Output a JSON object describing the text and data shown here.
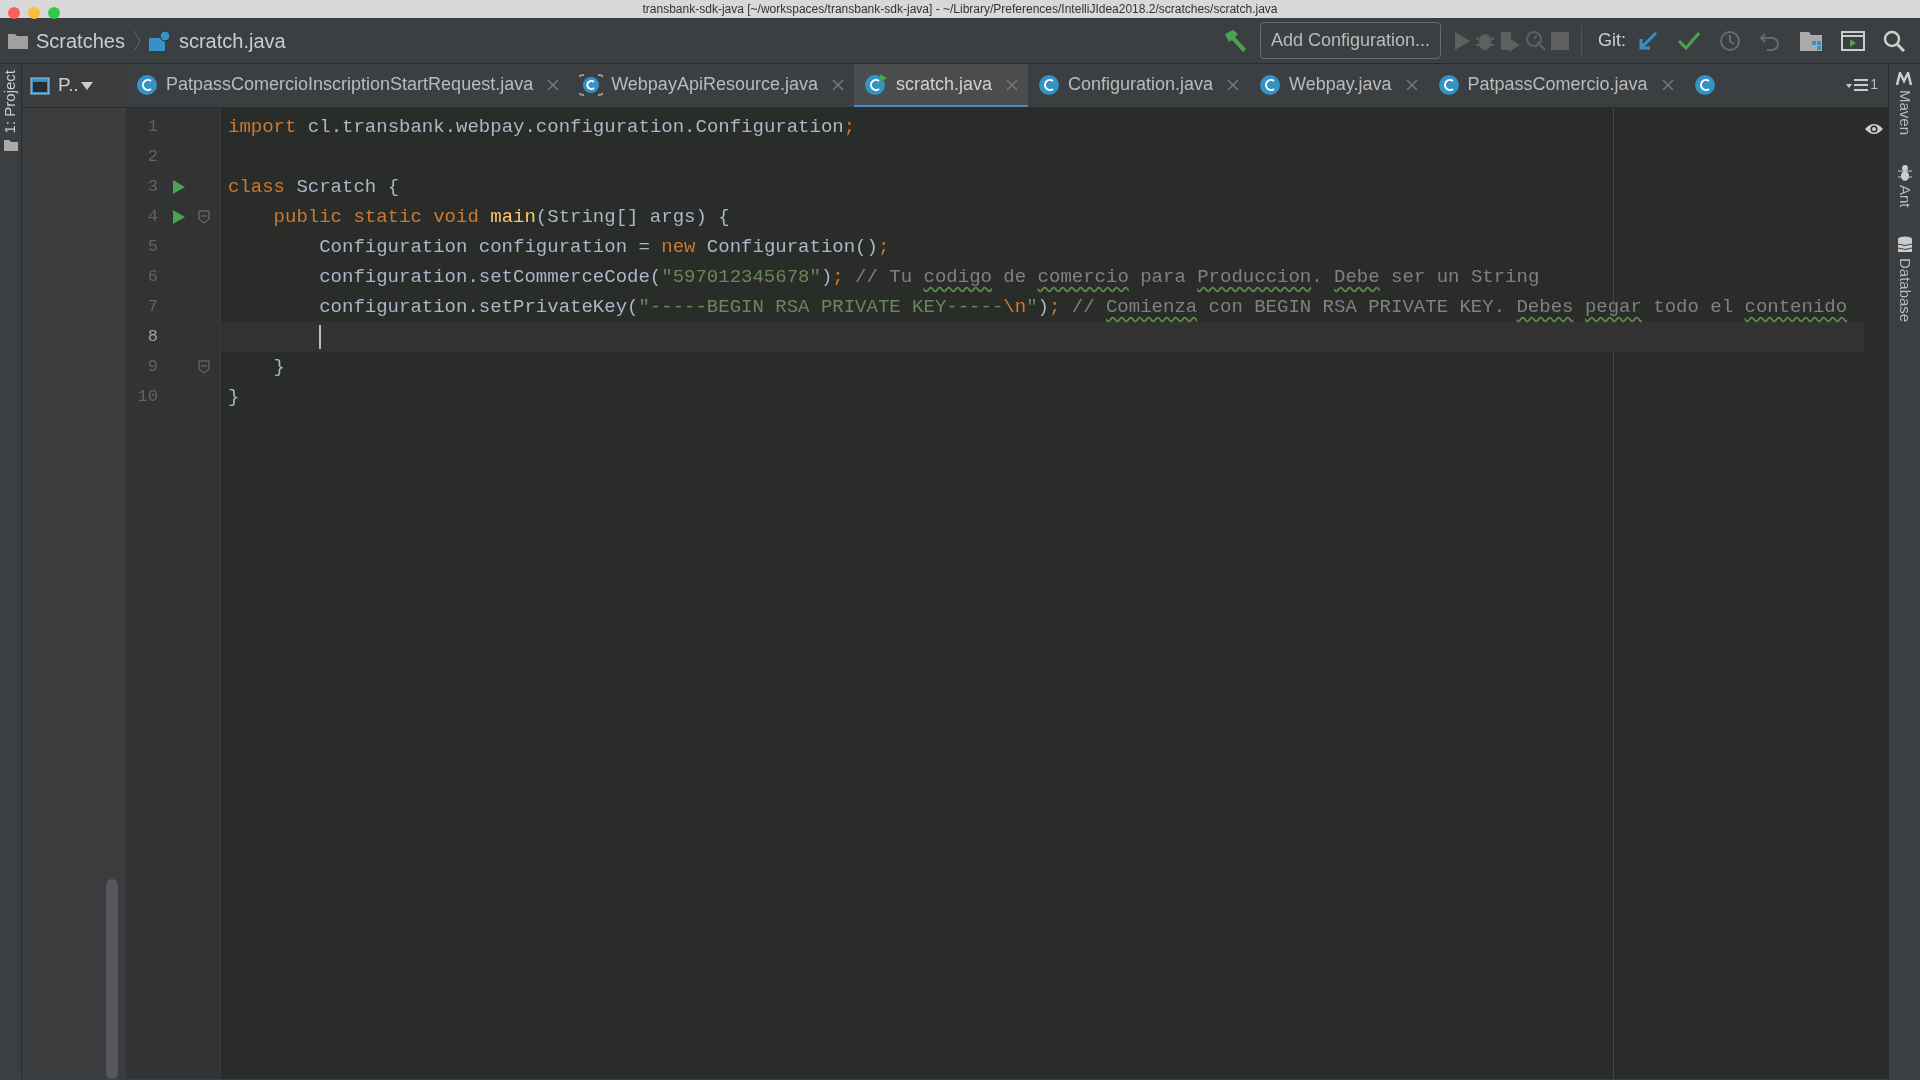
{
  "window": {
    "title": "transbank-sdk-java [~/workspaces/transbank-sdk-java] - ~/Library/Preferences/IntelliJIdea2018.2/scratches/scratch.java"
  },
  "breadcrumb": [
    {
      "label": "Scratches",
      "kind": "folder"
    },
    {
      "label": "scratch.java",
      "kind": "scratch"
    }
  ],
  "toolbar": {
    "config_button": "Add Configuration...",
    "git_label": "Git:",
    "run_buttons": [
      {
        "kind": "run",
        "disabled": true
      },
      {
        "kind": "debug",
        "disabled": true
      },
      {
        "kind": "coverage",
        "disabled": true
      },
      {
        "kind": "profile",
        "disabled": true
      },
      {
        "kind": "stop",
        "disabled": true
      }
    ]
  },
  "left_strip": {
    "label": "1: Project"
  },
  "project_panel": {
    "label": "P.."
  },
  "tabs": [
    {
      "label": "PatpassComercioInscriptionStartRequest.java",
      "kind": "class",
      "selected": false
    },
    {
      "label": "WebpayApiResource.java",
      "kind": "abstract",
      "selected": false
    },
    {
      "label": "scratch.java",
      "kind": "scratch",
      "selected": true
    },
    {
      "label": "Configuration.java",
      "kind": "class",
      "selected": false
    },
    {
      "label": "Webpay.java",
      "kind": "class",
      "selected": false
    },
    {
      "label": "PatpassComercio.java",
      "kind": "class",
      "selected": false
    },
    {
      "kind": "class",
      "selected": false
    }
  ],
  "tab_overflow": {
    "count": "1"
  },
  "editor": {
    "lines": [
      {
        "number": "1",
        "run": false,
        "fold": false,
        "current": false,
        "tokens": [
          {
            "kind": "keyword",
            "text": "import"
          },
          {
            "kind": "plain",
            "text": " cl.transbank.webpay.configuration.Configuration"
          },
          {
            "kind": "keyword",
            "text": ";"
          }
        ]
      },
      {
        "number": "2",
        "run": false,
        "fold": false,
        "current": false
      },
      {
        "number": "3",
        "run": true,
        "fold": false,
        "current": false,
        "tokens": [
          {
            "kind": "keyword",
            "text": "class"
          },
          {
            "kind": "plain",
            "text": " Scratch {"
          }
        ],
        "children": [
          {
            "number": "4",
            "run": true,
            "fold": true,
            "current": false,
            "tokens": [
              {
                "kind": "keyword",
                "text": "public static void "
              },
              {
                "kind": "method",
                "text": "main"
              },
              {
                "kind": "plain",
                "text": "(String[] args) {"
              }
            ],
            "children": [
              {
                "number": "5",
                "run": false,
                "fold": false,
                "current": false,
                "tokens": [
                  {
                    "kind": "plain",
                    "text": "Configuration configuration = "
                  },
                  {
                    "kind": "keyword",
                    "text": "new"
                  },
                  {
                    "kind": "plain",
                    "text": " Configuration()"
                  },
                  {
                    "kind": "keyword",
                    "text": ";"
                  }
                ]
              },
              {
                "number": "6",
                "run": false,
                "fold": false,
                "current": false,
                "tokens": [
                  {
                    "kind": "plain",
                    "text": "configuration.setCommerceCode("
                  },
                  {
                    "kind": "string",
                    "text": "\"597012345678\""
                  },
                  {
                    "kind": "plain",
                    "text": ")"
                  },
                  {
                    "kind": "keyword",
                    "text": ";"
                  },
                  {
                    "kind": "comment",
                    "text": " // Tu "
                  },
                  {
                    "kind": "typo",
                    "text": "codigo"
                  },
                  {
                    "kind": "comment",
                    "text": " de "
                  },
                  {
                    "kind": "typo",
                    "text": "comercio"
                  },
                  {
                    "kind": "comment",
                    "text": " para "
                  },
                  {
                    "kind": "typo",
                    "text": "Produccion"
                  },
                  {
                    "kind": "comment",
                    "text": ". "
                  },
                  {
                    "kind": "typo",
                    "text": "Debe"
                  },
                  {
                    "kind": "comment",
                    "text": " ser un String"
                  }
                ]
              },
              {
                "number": "7",
                "run": false,
                "fold": false,
                "current": false,
                "tokens": [
                  {
                    "kind": "plain",
                    "text": "configuration.setPrivateKey("
                  },
                  {
                    "kind": "string",
                    "text": "\"-----BEGIN RSA PRIVATE KEY-----"
                  },
                  {
                    "kind": "keyword",
                    "text": "\\n"
                  },
                  {
                    "kind": "string",
                    "text": "\""
                  },
                  {
                    "kind": "plain",
                    "text": ")"
                  },
                  {
                    "kind": "keyword",
                    "text": ";"
                  },
                  {
                    "kind": "comment",
                    "text": " // "
                  },
                  {
                    "kind": "typo",
                    "text": "Comienza"
                  },
                  {
                    "kind": "comment",
                    "text": " con BEGIN RSA PRIVATE KEY. "
                  },
                  {
                    "kind": "typo",
                    "text": "Debes "
                  },
                  {
                    "kind": "typo",
                    "text": "pegar"
                  },
                  {
                    "kind": "comment",
                    "text": " todo el "
                  },
                  {
                    "kind": "typo",
                    "text": "contenido"
                  }
                ]
              },
              {
                "number": "8",
                "run": false,
                "fold": false,
                "current": true,
                "caret": true
              }
            ]
          },
          {
            "number": "9",
            "run": false,
            "fold": true,
            "current": false,
            "tokens": [
              {
                "kind": "plain",
                "text": "}"
              }
            ]
          }
        ]
      },
      {
        "number": "10",
        "run": false,
        "fold": false,
        "current": false,
        "tokens": [
          {
            "kind": "plain",
            "text": "}"
          }
        ]
      }
    ]
  },
  "right_strip": [
    {
      "label": "Maven",
      "kind": "maven"
    },
    {
      "label": "Ant",
      "kind": "ant"
    },
    {
      "label": "Database",
      "kind": "database"
    }
  ]
}
